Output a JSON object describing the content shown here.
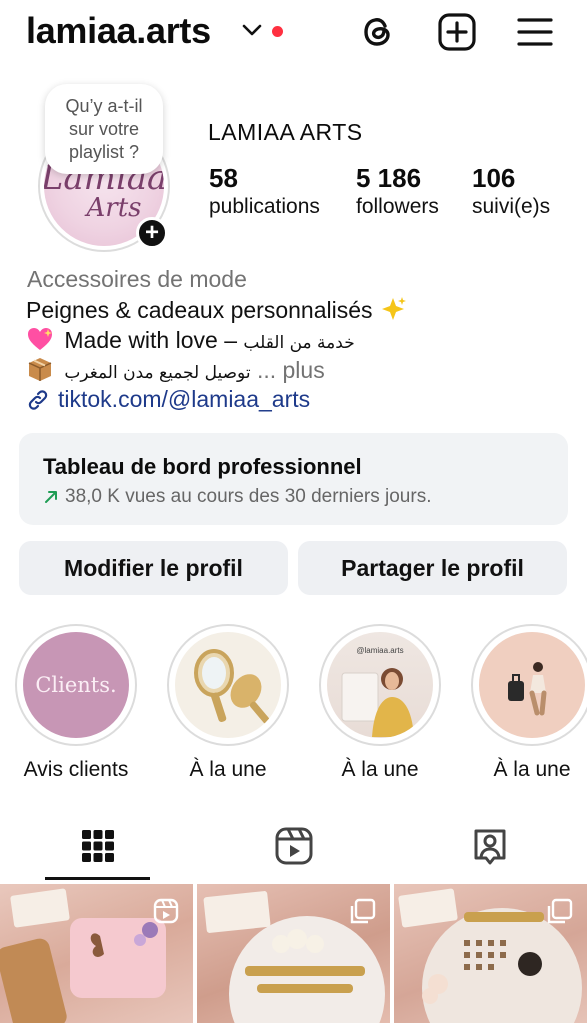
{
  "header": {
    "username": "lamiaa.arts",
    "icons": [
      "threads-icon",
      "new-post-icon",
      "menu-icon"
    ]
  },
  "note": {
    "text": "Qu’y a-t-il\nsur votre\nplaylist ?"
  },
  "avatar": {
    "line1": "Lamiaa",
    "line2": "Arts"
  },
  "profile": {
    "display_name": "LAMIAA ARTS",
    "stats": [
      {
        "value": "58",
        "label": "publications"
      },
      {
        "value": "5 186",
        "label": "followers"
      },
      {
        "value": "106",
        "label": "suivi(e)s"
      }
    ]
  },
  "bio": {
    "category": "Accessoires de mode",
    "line1": "Peignes & cadeaux personnalisés",
    "line2_en": "Made with love –",
    "line2_ar": "خدمة من القلب",
    "line3_ar": "توصيل لجميع مدن المغرب",
    "more": "... plus",
    "link": "tiktok.com/@lamiaa_arts"
  },
  "dashboard": {
    "title": "Tableau de bord professionnel",
    "subtitle": "38,0 K vues au cours des 30 derniers jours."
  },
  "buttons": {
    "edit": "Modifier le profil",
    "share": "Partager le profil"
  },
  "highlights": [
    {
      "label": "Avis clients",
      "cover_text": "Clients."
    },
    {
      "label": "À la une",
      "cover_text": ""
    },
    {
      "label": "À la une",
      "cover_text": "@lamiaa.arts"
    },
    {
      "label": "À la une",
      "cover_text": ""
    }
  ],
  "tabs": [
    "grid-icon",
    "reels-icon",
    "tagged-icon"
  ],
  "colors": {
    "accent_red": "#ff3040",
    "link": "#1e3a8a",
    "muted": "#737373",
    "button_bg": "#eef0f3",
    "trend_green": "#1f9d55"
  }
}
